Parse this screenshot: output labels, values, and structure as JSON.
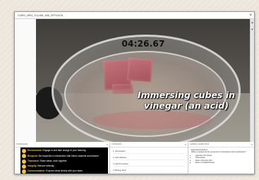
{
  "window": {
    "title": "CUBES_AREA_VOLUME_AND_DIFFUSION",
    "close_label": "×"
  },
  "video": {
    "timer": "04:26.67",
    "caption_line1": "Immersing cubes in",
    "caption_line2": "vinegar (an acid)"
  },
  "rail": {
    "up_arrow": "▲",
    "down_arrow": "▼"
  },
  "panels": {
    "strategies": {
      "header": "STRATEGIES",
      "items": [
        {
          "name": "Environment:",
          "text": "Engage in and take charge of your learning."
        },
        {
          "name": "Respond:",
          "text": "Be respectful in interactions with fellow students and teacher."
        },
        {
          "name": "Teamwork:",
          "text": "Share ideas, work together."
        },
        {
          "name": "Integrity:",
          "text": "Behave ethically."
        },
        {
          "name": "Communication:",
          "text": "Express ideas clearly with your team."
        }
      ]
    },
    "contents": {
      "header": "CONTENTS",
      "items": [
        "1. Introduction",
        "2. Lab Handout",
        "3. Lab Procedure",
        "4. Biology Quiz"
      ]
    },
    "questions": {
      "header": "GUIDING QUESTIONS",
      "title": "Essential Questions",
      "lead": "What is needed for the movement of cell division and reproduction?",
      "bullets": [
        "Agenda: Intro Notes",
        "Pharmacies",
        "Exam 2 Review Part",
        "Exam 4 Guided Review"
      ]
    }
  },
  "colors": {
    "accent_yellow": "#f3c23a",
    "caption_text": "#ffffff",
    "panel_bg": "#000000"
  }
}
